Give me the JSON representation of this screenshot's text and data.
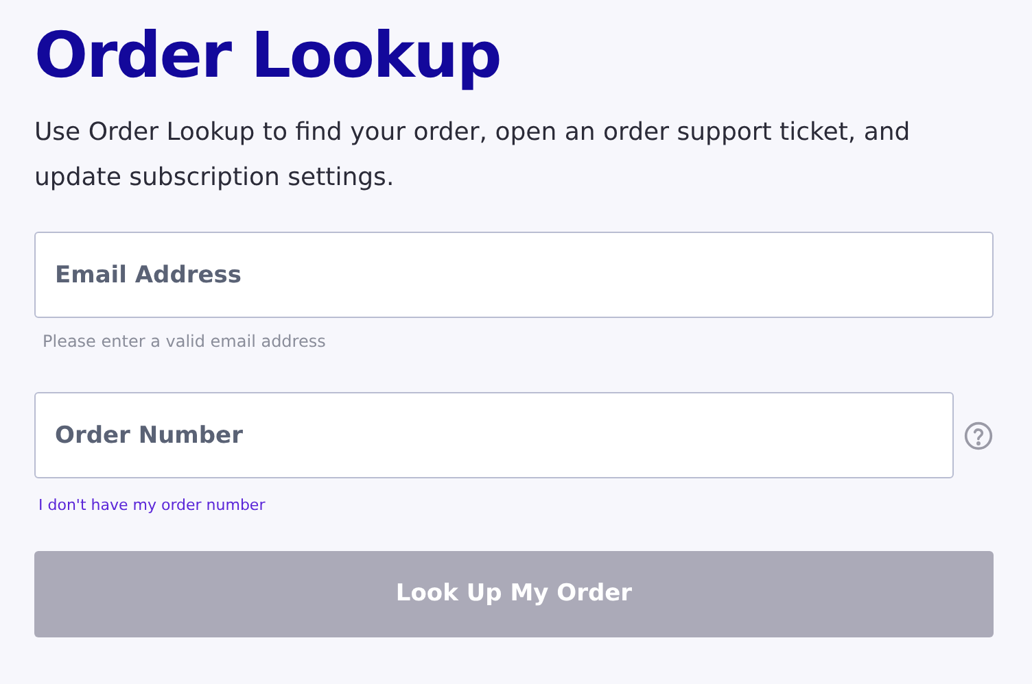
{
  "title": "Order Lookup",
  "description": "Use Order Lookup to find your order, open an order support ticket, and update subscription settings.",
  "email_field": {
    "placeholder": "Email Address",
    "hint": "Please enter a valid email address"
  },
  "order_field": {
    "placeholder": "Order Number",
    "link": "I don't have my order number"
  },
  "submit_button": {
    "label": "Look Up My Order",
    "disabled": true
  }
}
